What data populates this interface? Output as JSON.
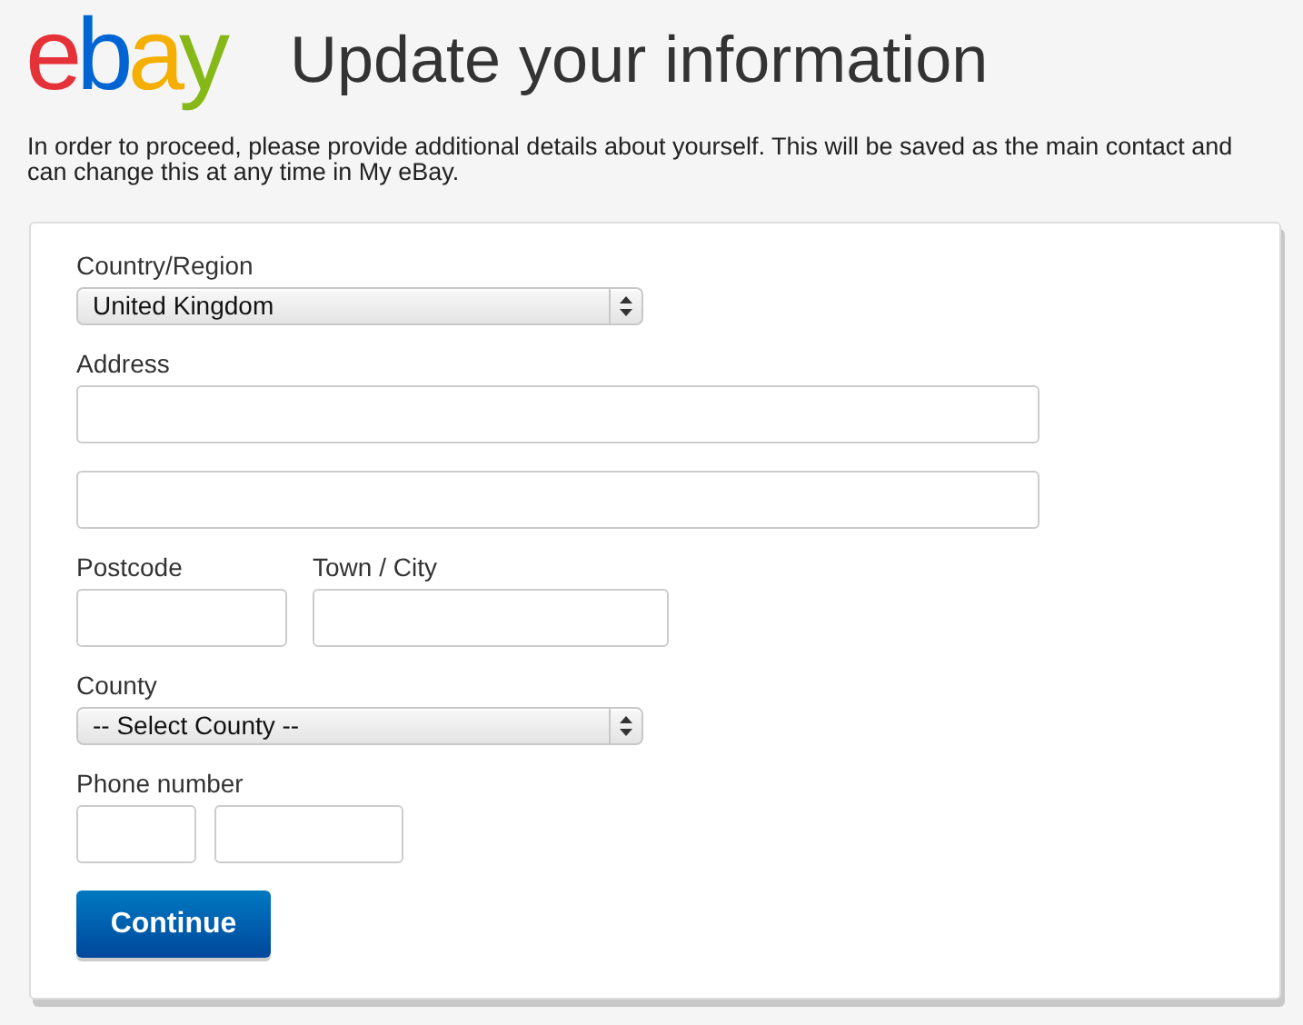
{
  "logo": {
    "letters": [
      {
        "char": "e",
        "color": "#e53238"
      },
      {
        "char": "b",
        "color": "#0064d2"
      },
      {
        "char": "a",
        "color": "#f5af02"
      },
      {
        "char": "y",
        "color": "#86b817"
      }
    ]
  },
  "title": "Update your information",
  "intro": [
    "In order to proceed, please provide additional details about yourself. This will be saved as the main contact and",
    "can change this at any time in My eBay."
  ],
  "form": {
    "rows": [
      {
        "kind": "select",
        "label": "Country/Region",
        "value": "United Kingdom"
      },
      {
        "kind": "address",
        "label": "Address"
      },
      {
        "kind": "address"
      },
      {
        "kind": "pair",
        "items": [
          {
            "label": "Postcode"
          },
          {
            "label": "Town / City"
          }
        ]
      },
      {
        "kind": "select",
        "label": "County",
        "value": "-- Select County --"
      },
      {
        "kind": "phone",
        "label": "Phone number"
      }
    ],
    "submit": "Continue"
  }
}
